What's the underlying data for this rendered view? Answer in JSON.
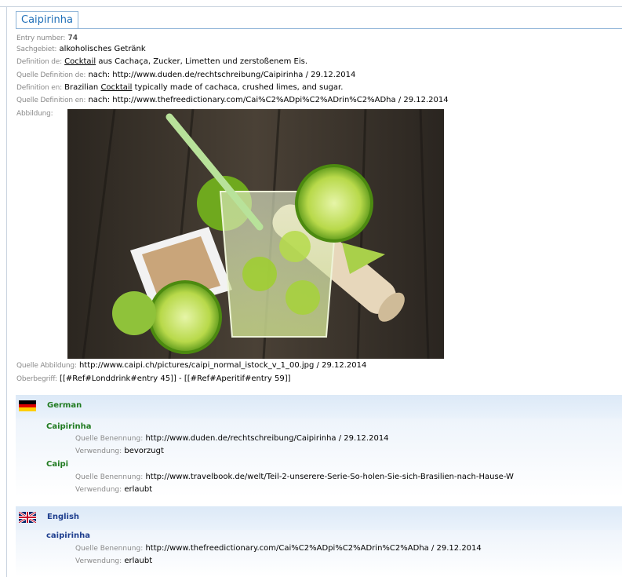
{
  "tab": {
    "title": "Caipirinha"
  },
  "entry": {
    "number_label": "Entry number:",
    "number": "74",
    "subject_label": "Sachgebiet:",
    "subject": "alkoholisches Getränk",
    "def_de_label": "Definition de:",
    "def_de_link": "Cocktail",
    "def_de_rest": "aus Cachaça, Zucker, Limetten und zerstoßenem Eis.",
    "src_def_de_label": "Quelle Definition de:",
    "src_def_de": "nach: http://www.duden.de/rechtschreibung/Caipirinha / 29.12.2014",
    "def_en_label": "Definition en:",
    "def_en_pre": "Brazilian",
    "def_en_link": "Cocktail",
    "def_en_rest": "typically made of cachaca, crushed limes, and sugar.",
    "src_def_en_label": "Quelle Definition en:",
    "src_def_en": "nach: http://www.thefreedictionary.com/Cai%C2%ADpi%C2%ADrin%C2%ADha / 29.12.2014",
    "image_label": "Abbildung:",
    "src_image_label": "Quelle Abbildung:",
    "src_image": "http://www.caipi.ch/pictures/caipi_normal_istock_v_1_00.jpg / 29.12.2014",
    "broader_label": "Oberbegriff:",
    "broader": "[[#Ref#Londdrink#entry 45]] - [[#Ref#Aperitif#entry 59]]"
  },
  "languages": [
    {
      "name": "German",
      "flag": "de-flag-icon",
      "terms": [
        {
          "term": "Caipirinha",
          "source_label": "Quelle Benennung:",
          "source": "http://www.duden.de/rechtschreibung/Caipirinha / 29.12.2014",
          "usage_label": "Verwendung:",
          "usage": "bevorzugt"
        },
        {
          "term": "Caipi",
          "source_label": "Quelle Benennung:",
          "source": "http://www.travelbook.de/welt/Teil-2-unserere-Serie-So-holen-Sie-sich-Brasilien-nach-Hause-W",
          "usage_label": "Verwendung:",
          "usage": "erlaubt"
        }
      ]
    },
    {
      "name": "English",
      "flag": "uk-flag-icon",
      "terms": [
        {
          "term": "caipirinha",
          "source_label": "Quelle Benennung:",
          "source": "http://www.thefreedictionary.com/Cai%C2%ADpi%C2%ADrin%C2%ADha / 29.12.2014",
          "usage_label": "Verwendung:",
          "usage": "erlaubt"
        }
      ]
    }
  ],
  "colors": {
    "accent": "#1f6fb8",
    "term_de": "#1f7a1f",
    "term_en": "#1f3f8f",
    "band": "#dce9f7"
  }
}
